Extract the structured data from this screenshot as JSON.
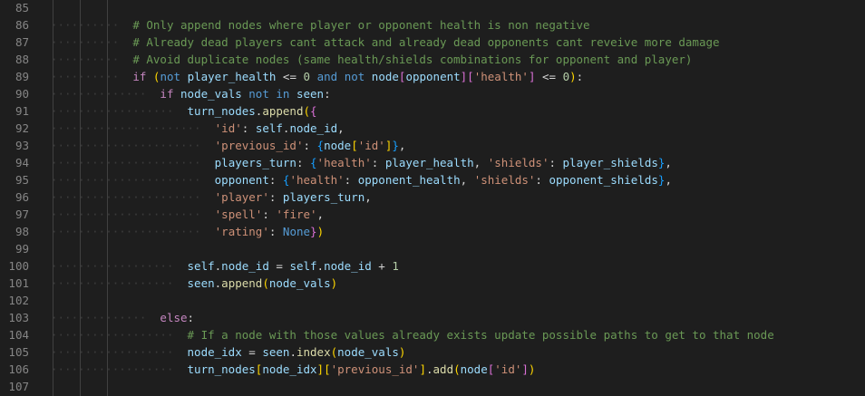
{
  "editor": {
    "lines": [
      {
        "num": "85",
        "indent": 0,
        "tokens": []
      },
      {
        "num": "86",
        "indent": 3,
        "tokens": [
          [
            "comment",
            "# Only append nodes where player or opponent health is non negative"
          ]
        ]
      },
      {
        "num": "87",
        "indent": 3,
        "tokens": [
          [
            "comment",
            "# Already dead players cant attack and already dead opponents cant reveive more damage"
          ]
        ]
      },
      {
        "num": "88",
        "indent": 3,
        "tokens": [
          [
            "comment",
            "# Avoid duplicate nodes (same health/shields combinations for opponent and player)"
          ]
        ]
      },
      {
        "num": "89",
        "indent": 3,
        "tokens": [
          [
            "kw",
            "if"
          ],
          [
            "punc",
            " "
          ],
          [
            "b1",
            "("
          ],
          [
            "op",
            "not"
          ],
          [
            "punc",
            " "
          ],
          [
            "var",
            "player_health"
          ],
          [
            "punc",
            " <= "
          ],
          [
            "num",
            "0"
          ],
          [
            "punc",
            " "
          ],
          [
            "op",
            "and"
          ],
          [
            "punc",
            " "
          ],
          [
            "op",
            "not"
          ],
          [
            "punc",
            " "
          ],
          [
            "var",
            "node"
          ],
          [
            "b2",
            "["
          ],
          [
            "var",
            "opponent"
          ],
          [
            "b2",
            "]["
          ],
          [
            "str",
            "'health'"
          ],
          [
            "b2",
            "]"
          ],
          [
            "punc",
            " <= "
          ],
          [
            "num",
            "0"
          ],
          [
            "b1",
            ")"
          ],
          [
            "punc",
            ":"
          ]
        ]
      },
      {
        "num": "90",
        "indent": 4,
        "tokens": [
          [
            "kw",
            "if"
          ],
          [
            "punc",
            " "
          ],
          [
            "var",
            "node_vals"
          ],
          [
            "punc",
            " "
          ],
          [
            "op",
            "not"
          ],
          [
            "punc",
            " "
          ],
          [
            "op",
            "in"
          ],
          [
            "punc",
            " "
          ],
          [
            "var",
            "seen"
          ],
          [
            "punc",
            ":"
          ]
        ]
      },
      {
        "num": "91",
        "indent": 5,
        "tokens": [
          [
            "var",
            "turn_nodes"
          ],
          [
            "punc",
            "."
          ],
          [
            "fn",
            "append"
          ],
          [
            "b1",
            "("
          ],
          [
            "b2",
            "{"
          ]
        ]
      },
      {
        "num": "92",
        "indent": 6,
        "tokens": [
          [
            "str",
            "'id'"
          ],
          [
            "punc",
            ": "
          ],
          [
            "var",
            "self"
          ],
          [
            "punc",
            "."
          ],
          [
            "var",
            "node_id"
          ],
          [
            "punc",
            ","
          ]
        ]
      },
      {
        "num": "93",
        "indent": 6,
        "tokens": [
          [
            "str",
            "'previous_id'"
          ],
          [
            "punc",
            ": "
          ],
          [
            "b3",
            "{"
          ],
          [
            "var",
            "node"
          ],
          [
            "b1",
            "["
          ],
          [
            "str",
            "'id'"
          ],
          [
            "b1",
            "]"
          ],
          [
            "b3",
            "}"
          ],
          [
            "punc",
            ","
          ]
        ]
      },
      {
        "num": "94",
        "indent": 6,
        "tokens": [
          [
            "var",
            "players_turn"
          ],
          [
            "punc",
            ": "
          ],
          [
            "b3",
            "{"
          ],
          [
            "str",
            "'health'"
          ],
          [
            "punc",
            ": "
          ],
          [
            "var",
            "player_health"
          ],
          [
            "punc",
            ", "
          ],
          [
            "str",
            "'shields'"
          ],
          [
            "punc",
            ": "
          ],
          [
            "var",
            "player_shields"
          ],
          [
            "b3",
            "}"
          ],
          [
            "punc",
            ","
          ]
        ]
      },
      {
        "num": "95",
        "indent": 6,
        "tokens": [
          [
            "var",
            "opponent"
          ],
          [
            "punc",
            ": "
          ],
          [
            "b3",
            "{"
          ],
          [
            "str",
            "'health'"
          ],
          [
            "punc",
            ": "
          ],
          [
            "var",
            "opponent_health"
          ],
          [
            "punc",
            ", "
          ],
          [
            "str",
            "'shields'"
          ],
          [
            "punc",
            ": "
          ],
          [
            "var",
            "opponent_shields"
          ],
          [
            "b3",
            "}"
          ],
          [
            "punc",
            ","
          ]
        ]
      },
      {
        "num": "96",
        "indent": 6,
        "tokens": [
          [
            "str",
            "'player'"
          ],
          [
            "punc",
            ": "
          ],
          [
            "var",
            "players_turn"
          ],
          [
            "punc",
            ","
          ]
        ]
      },
      {
        "num": "97",
        "indent": 6,
        "tokens": [
          [
            "str",
            "'spell'"
          ],
          [
            "punc",
            ": "
          ],
          [
            "str",
            "'fire'"
          ],
          [
            "punc",
            ","
          ]
        ]
      },
      {
        "num": "98",
        "indent": 6,
        "tokens": [
          [
            "str",
            "'rating'"
          ],
          [
            "punc",
            ": "
          ],
          [
            "op",
            "None"
          ],
          [
            "b2",
            "}"
          ],
          [
            "b1",
            ")"
          ]
        ]
      },
      {
        "num": "99",
        "indent": 0,
        "tokens": []
      },
      {
        "num": "100",
        "indent": 5,
        "tokens": [
          [
            "var",
            "self"
          ],
          [
            "punc",
            "."
          ],
          [
            "var",
            "node_id"
          ],
          [
            "punc",
            " = "
          ],
          [
            "var",
            "self"
          ],
          [
            "punc",
            "."
          ],
          [
            "var",
            "node_id"
          ],
          [
            "punc",
            " + "
          ],
          [
            "num",
            "1"
          ]
        ]
      },
      {
        "num": "101",
        "indent": 5,
        "tokens": [
          [
            "var",
            "seen"
          ],
          [
            "punc",
            "."
          ],
          [
            "fn",
            "append"
          ],
          [
            "b1",
            "("
          ],
          [
            "var",
            "node_vals"
          ],
          [
            "b1",
            ")"
          ]
        ]
      },
      {
        "num": "102",
        "indent": 0,
        "tokens": []
      },
      {
        "num": "103",
        "indent": 4,
        "tokens": [
          [
            "kw",
            "else"
          ],
          [
            "punc",
            ":"
          ]
        ]
      },
      {
        "num": "104",
        "indent": 5,
        "tokens": [
          [
            "comment",
            "# If a node with those values already exists update possible paths to get to that node"
          ]
        ]
      },
      {
        "num": "105",
        "indent": 5,
        "tokens": [
          [
            "var",
            "node_idx"
          ],
          [
            "punc",
            " = "
          ],
          [
            "var",
            "seen"
          ],
          [
            "punc",
            "."
          ],
          [
            "fn",
            "index"
          ],
          [
            "b1",
            "("
          ],
          [
            "var",
            "node_vals"
          ],
          [
            "b1",
            ")"
          ]
        ]
      },
      {
        "num": "106",
        "indent": 5,
        "tokens": [
          [
            "var",
            "turn_nodes"
          ],
          [
            "b1",
            "["
          ],
          [
            "var",
            "node_idx"
          ],
          [
            "b1",
            "]["
          ],
          [
            "str",
            "'previous_id'"
          ],
          [
            "b1",
            "]"
          ],
          [
            "punc",
            "."
          ],
          [
            "fn",
            "add"
          ],
          [
            "b1",
            "("
          ],
          [
            "var",
            "node"
          ],
          [
            "b2",
            "["
          ],
          [
            "str",
            "'id'"
          ],
          [
            "b2",
            "]"
          ],
          [
            "b1",
            ")"
          ]
        ]
      },
      {
        "num": "107",
        "indent": 0,
        "tokens": []
      }
    ]
  }
}
